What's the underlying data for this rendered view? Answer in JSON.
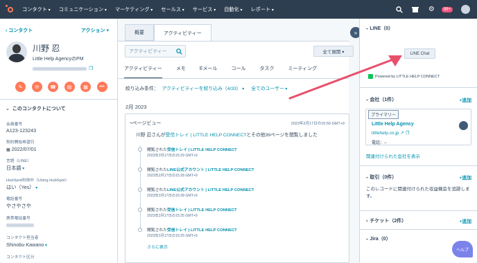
{
  "nav": {
    "items": [
      "コンタクト",
      "コミュニケーション",
      "マーケティング",
      "セールス",
      "サービス",
      "自動化",
      "レポート"
    ],
    "notification_count": "99+"
  },
  "contact": {
    "back_label": "‹ コンタクト",
    "actions_label": "アクション ▾",
    "name": "川野 忍",
    "role": "Little Help AgencyのPM",
    "about_title": "このコンタクトについて",
    "properties": [
      {
        "label": "会員番号",
        "value": "A123-123243"
      },
      {
        "label": "契約開始希望日",
        "value": "2022/07/01"
      },
      {
        "label": "言語（LINE）",
        "value": "日本語"
      },
      {
        "label": "HubSpot利用中（Using HubSpot）",
        "value": "はい（Yes）"
      },
      {
        "label": "電話番号",
        "value": "やさやさや"
      },
      {
        "label": "携帯電話番号",
        "value": ""
      },
      {
        "label": "コンタクト担当者",
        "value": "Shinobu Kawano"
      },
      {
        "label": "コンタクト区分",
        "value": ""
      }
    ]
  },
  "center": {
    "tabs": [
      "概要",
      "アクティビティー"
    ],
    "search_placeholder": "アクティビティー",
    "expand_label": "全て展開 ▾",
    "subtabs": [
      "アクティビティー",
      "メモ",
      "Eメール",
      "コール",
      "タスク",
      "ミーティング"
    ],
    "filter_label": "絞り込み条件：",
    "filter_activity": "アクティビティーを絞り込み（4/33）",
    "filter_users": "全てのユーザー",
    "month": "2月 2023",
    "card": {
      "title": "ページビュー",
      "date": "2023年2月17日の15:50 GMT+9",
      "summary_prefix": "川野 忍さんが",
      "summary_link": "受信トレイ | LITTLE HELP CONNECT",
      "summary_suffix": "とその他39ページを閲覧しました",
      "items": [
        {
          "prefix": "閲覧された",
          "page": "受信トレイ | LITTLE HELP CONNECT",
          "time": "2023年2月17日の15:29 GMT+9"
        },
        {
          "prefix": "閲覧された",
          "page": "LINE公式アカウント | LITTLE HELP CONNECT",
          "time": "2023年2月17日の15:28 GMT+9"
        },
        {
          "prefix": "閲覧された",
          "page": "LINE公式アカウント | LITTLE HELP CONNECT",
          "time": "2023年2月17日の15:28 GMT+9"
        },
        {
          "prefix": "閲覧された",
          "page": "受信トレイ | LITTLE HELP CONNECT",
          "time": "2023年2月17日の15:25 GMT+9"
        },
        {
          "prefix": "閲覧された",
          "page": "受信トレイ | LITTLE HELP CONNECT",
          "time": "2023年2月17日の15:25 GMT+9"
        }
      ],
      "more_label": "さらに表示"
    }
  },
  "right": {
    "line_title": "LINE（0）",
    "line_chat_label": "LINE Chat",
    "powered_label": "Powered by LITTLE HELP CONNECT",
    "company_title": "会社（1件）",
    "add_label": "+追加",
    "primary_label": "プライマリー",
    "company_name": "Little Help Agency",
    "company_domain": "littlehelp.co.jp",
    "company_phone": "電話：--",
    "company_link": "関連付けられた会社を表示",
    "deals_title": "取引（0件）",
    "deals_text": "このレコードに関連付けられた収益機会を追跡します。",
    "tickets_title": "チケット（2件）",
    "jira_title": "Jira（0）",
    "help_label": "ヘルプ"
  }
}
